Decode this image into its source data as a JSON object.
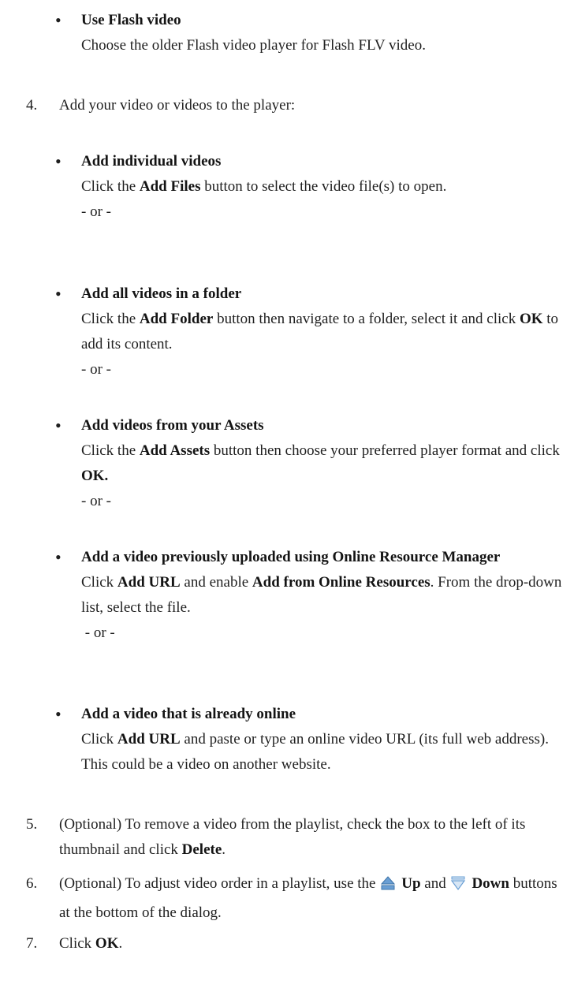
{
  "flash_item": {
    "title": "Use Flash video",
    "desc": "Choose the older Flash video player for Flash FLV video."
  },
  "step4": {
    "number": "4.",
    "text": "Add your video or videos to the player:",
    "items": [
      {
        "title": "Add individual videos",
        "pre": "Click the ",
        "bold1": "Add Files",
        "mid": " button to select the video file(s) to open.",
        "or": "- or -"
      },
      {
        "title": "Add all videos in a folder",
        "pre": "Click the ",
        "bold1": "Add Folder",
        "mid": " button then navigate to a folder, select it and click ",
        "bold2": "OK",
        "post": " to add its content.",
        "or": "- or -"
      },
      {
        "title": "Add videos from your Assets",
        "pre": "Click the ",
        "bold1": "Add Assets",
        "mid": " button then choose your preferred player format and click ",
        "bold2": "OK.",
        "or": "- or -"
      },
      {
        "title": "Add a video previously uploaded using Online Resource Manager",
        "pre": "Click ",
        "bold1": "Add URL",
        "mid": " and enable ",
        "bold2": "Add from Online Resources",
        "post": ". From the drop-down list, select the file.",
        "or": " - or -"
      },
      {
        "title": "Add a video that is already online",
        "pre": "Click ",
        "bold1": "Add URL",
        "mid": " and paste or type an online video URL (its full web address). This could be a video on another website."
      }
    ]
  },
  "step5": {
    "number": "5.",
    "pre": "(Optional) To remove a video from the playlist, check the box to the left of its thumbnail and click ",
    "bold": "Delete",
    "post": "."
  },
  "step6": {
    "number": "6.",
    "pre": "(Optional) To adjust video order in a playlist, use the ",
    "up_label": "Up",
    "and": " and ",
    "down_label": "Down",
    "post": " buttons at the bottom of the dialog.",
    "up_icon": "up-arrow-icon",
    "down_icon": "down-arrow-icon",
    "icon_color": "#6a9fd4"
  },
  "step7": {
    "number": "7.",
    "pre": "Click ",
    "bold": "OK",
    "post": "."
  }
}
